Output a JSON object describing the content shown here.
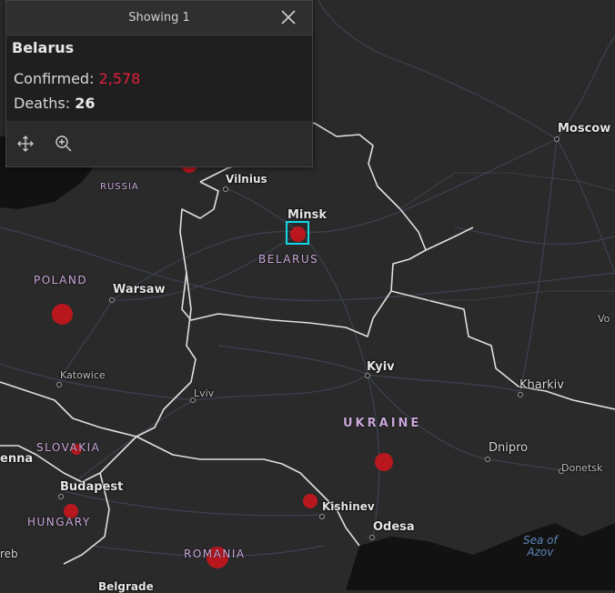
{
  "popup": {
    "header": "Showing 1",
    "title": "Belarus",
    "confirmed_label": "Confirmed:",
    "confirmed_value": "2,578",
    "deaths_label": "Deaths:",
    "deaths_value": "26",
    "icons": [
      "close-icon",
      "pan-move-icon",
      "zoom-in-icon"
    ],
    "colors": {
      "confirmed": "#e3203f",
      "background": "#1f1f1f"
    }
  },
  "map": {
    "cities": {
      "moscow": "Moscow",
      "vilnius": "Vilnius",
      "minsk": "Minsk",
      "warsaw": "Warsaw",
      "katowice": "Katowice",
      "lviv": "Lviv",
      "kyiv": "Kyiv",
      "kharkiv": "Kharkiv",
      "dnipro": "Dnipro",
      "donetsk": "Donetsk",
      "budapest": "Budapest",
      "kishinev": "Kishinev",
      "odesa": "Odesa",
      "vienna_partial": "enna",
      "zagreb_partial": "reb",
      "belgrade_partial": "Belgrade",
      "vo_partial": "Vo"
    },
    "countries": {
      "russia": "RUSSIA",
      "poland": "POLAND",
      "belarus": "BELARUS",
      "ukraine": "UKRAINE",
      "slovakia": "SLOVAKIA",
      "hungary": "HUNGARY",
      "romania": "ROMANIA"
    },
    "seas": {
      "azov_line1": "Sea of",
      "azov_line2": "Azov"
    },
    "colors": {
      "case_marker": "#c6161d",
      "selection": "#14d6e6",
      "land": "#2a2a2a",
      "water": "#101010",
      "border": "#e0e0e0"
    }
  }
}
